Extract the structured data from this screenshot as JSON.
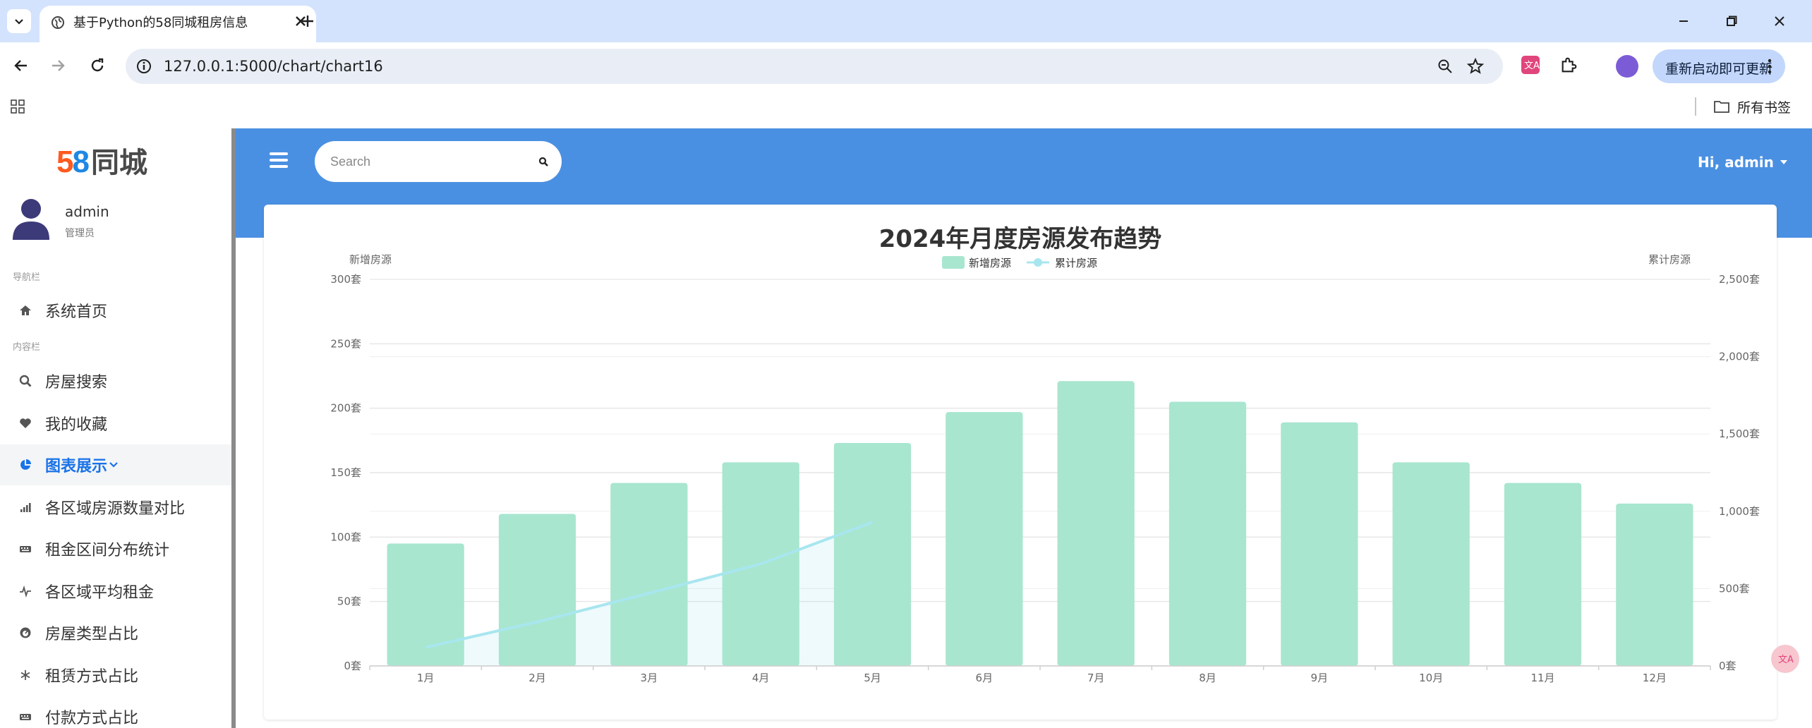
{
  "browser": {
    "tab_title": "基于Python的58同城租房信息",
    "url": "127.0.0.1:5000/chart/chart16",
    "update_button": "重新启动即可更新",
    "all_bookmarks": "所有书签"
  },
  "app": {
    "logo": {
      "num_5": "5",
      "num_8": "8",
      "text": "同城"
    },
    "user": {
      "name": "admin",
      "role": "管理员"
    },
    "sections": {
      "nav": "导航栏",
      "content": "内容栏"
    },
    "nav_items": [
      {
        "label": "系统首页",
        "icon": "home-icon"
      },
      {
        "label": "房屋搜索",
        "icon": "search-icon"
      },
      {
        "label": "我的收藏",
        "icon": "heart-icon"
      },
      {
        "label": "图表展示",
        "icon": "pie-chart-icon",
        "active": true
      },
      {
        "label": "各区域房源数量对比",
        "icon": "bar-signal-icon"
      },
      {
        "label": "租金区间分布统计",
        "icon": "keyboard-icon"
      },
      {
        "label": "各区域平均租金",
        "icon": "pulse-icon"
      },
      {
        "label": "房屋类型占比",
        "icon": "gauge-icon"
      },
      {
        "label": "租赁方式占比",
        "icon": "asterisk-icon"
      },
      {
        "label": "付款方式占比",
        "icon": "keyboard-icon"
      }
    ],
    "search": {
      "placeholder": "Search"
    },
    "greeting": "Hi, admin",
    "colors": {
      "topbar": "#4a90e2",
      "bar": "#a8e6cf",
      "line": "#a8e6ef",
      "active": "#1a73e8"
    }
  },
  "chart_data": {
    "type": "bar",
    "title": "2024年月度房源发布趋势",
    "categories": [
      "1月",
      "2月",
      "3月",
      "4月",
      "5月",
      "6月",
      "7月",
      "8月",
      "9月",
      "10月",
      "11月",
      "12月"
    ],
    "series": [
      {
        "name": "新增房源",
        "type": "bar",
        "axis": "left",
        "values": [
          95,
          118,
          142,
          158,
          173,
          197,
          221,
          205,
          189,
          158,
          142,
          126
        ]
      },
      {
        "name": "累计房源",
        "type": "line",
        "axis": "right",
        "values": [
          120,
          285,
          470,
          660,
          930
        ]
      }
    ],
    "ylabel_left": "新增房源",
    "ylabel_right": "累计房源",
    "ylim_left": [
      0,
      300
    ],
    "ylim_right": [
      0,
      2500
    ],
    "yticks_left": [
      "0套",
      "50套",
      "100套",
      "150套",
      "200套",
      "250套",
      "300套"
    ],
    "yticks_right": [
      "0套",
      "500套",
      "1,000套",
      "1,500套",
      "2,000套",
      "2,500套"
    ],
    "legend": "top-center",
    "grid": true
  }
}
